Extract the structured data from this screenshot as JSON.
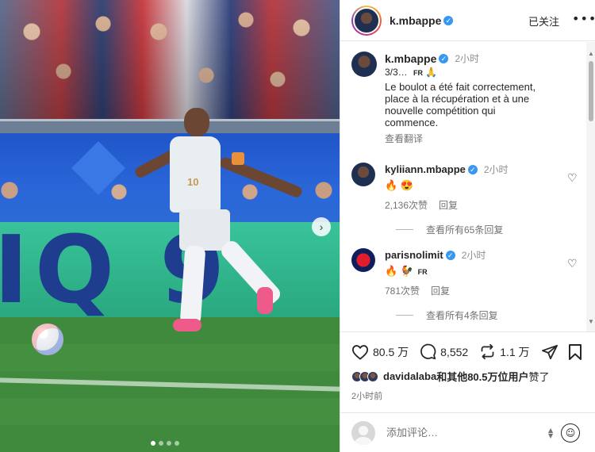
{
  "post": {
    "author": "k.mbappe",
    "follow_label": "已关注",
    "more_label": "•••",
    "next_label": "›",
    "carousel_count": 4
  },
  "caption": {
    "author": "k.mbappe",
    "time": "2小时",
    "prefix": "3/3…",
    "flag_text": "FR",
    "emoji": "🙏",
    "text": "Le boulot a été fait correctement,\nplace à la récupération et à une\nnouvelle compétition qui\ncommence.",
    "translate_label": "查看翻译"
  },
  "comments": [
    {
      "author": "kyliiann.mbappe",
      "time": "2小时",
      "emoji": "🔥 😍",
      "flag_text": "",
      "likes": "2,136次赞",
      "reply_label": "回复",
      "view_replies": "查看所有65条回复"
    },
    {
      "author": "parisnolimit",
      "time": "2小时",
      "emoji": "🔥 🐓",
      "flag_text": "FR",
      "likes": "781次赞",
      "reply_label": "回复",
      "view_replies": "查看所有4条回复"
    }
  ],
  "actions": {
    "likes_count": "80.5 万",
    "comments_count": "8,552",
    "reposts_count": "1.1 万"
  },
  "liked_by": {
    "user": "davidalaba",
    "rest": "和其他80.5万位用户",
    "suffix": "赞了"
  },
  "post_time": "2小时前",
  "compose": {
    "placeholder": "添加评论…",
    "emoji_icon": "☺"
  },
  "photo": {
    "billboard_text": "IQ 9",
    "jersey_number": "10"
  }
}
